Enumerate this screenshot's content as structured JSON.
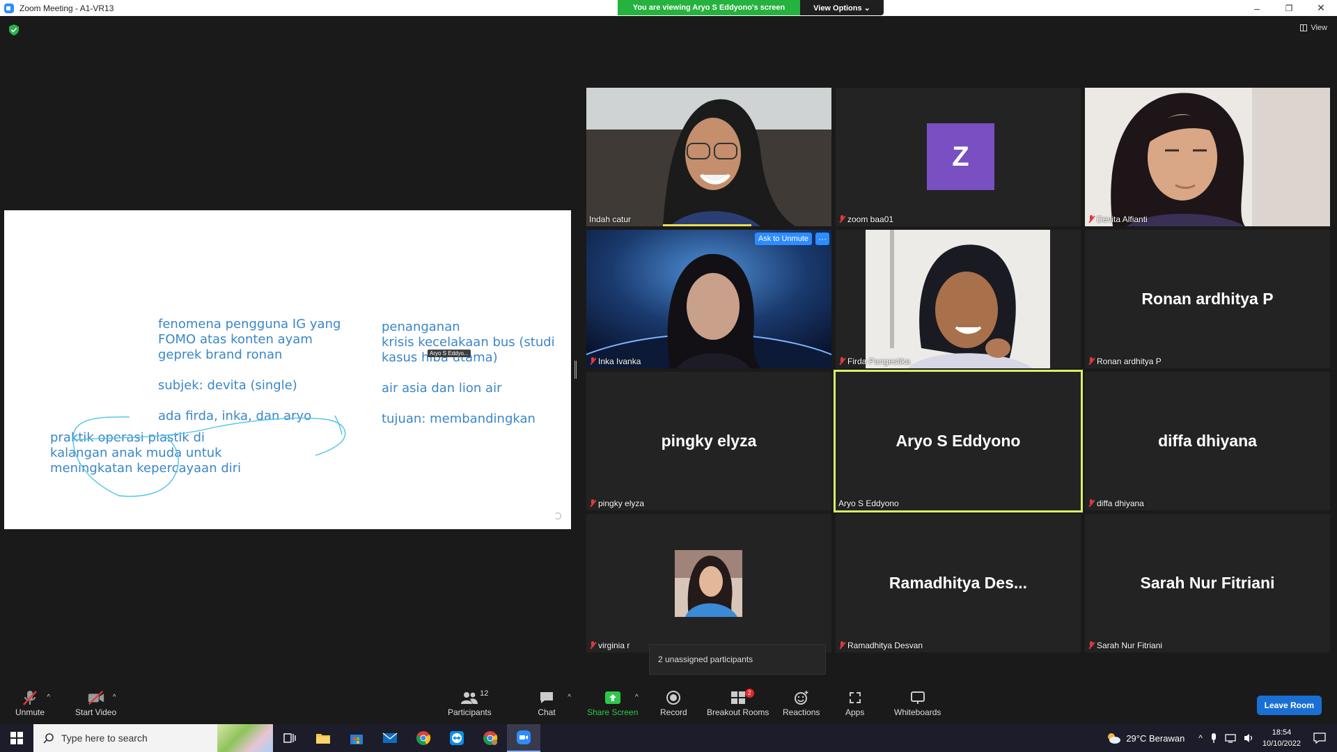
{
  "window": {
    "title": "Zoom Meeting - A1-VR13",
    "minimize": "–",
    "restore": "❐",
    "close": "✕"
  },
  "banner": {
    "message": "You are viewing Aryo S Eddyono's screen",
    "view_options": "View Options ⌄"
  },
  "view_button": "View",
  "shared_screen": {
    "left_block": "fenomena pengguna IG yang\nFOMO atas konten ayam\ngeprek brand ronan\n\nsubjek: devita (single)\n\nada firda, inka, dan aryo",
    "bottom_left_block": "praktik operasi plastik di\nkalangan anak muda untuk\nmeningkatan kepercayaan diri",
    "right_block": "penanganan\nkrisis kecelakaan bus (studi\nkasus hiba utama)\n\nair asia dan lion air\n\ntujuan: membandingkan",
    "cursor_label": "Aryo S Eddyo..."
  },
  "participants_grid": [
    {
      "name": "Indah catur",
      "type": "video",
      "muted": false
    },
    {
      "name": "zoom baa01",
      "type": "avatar",
      "initial": "Z",
      "muted": true
    },
    {
      "name": "Devita Alfianti",
      "type": "video",
      "muted": true
    },
    {
      "name": "Inka Ivanka",
      "type": "video",
      "muted": true
    },
    {
      "name": "Firda Pangestika",
      "type": "video",
      "muted": true
    },
    {
      "name": "Ronan ardhitya P",
      "display": "Ronan ardhitya P",
      "type": "name",
      "muted": true
    },
    {
      "name": "pingky elyza",
      "display": "pingky elyza",
      "type": "name",
      "muted": true
    },
    {
      "name": "Aryo S Eddyono",
      "display": "Aryo S Eddyono",
      "type": "name",
      "muted": false,
      "active_speaker": true
    },
    {
      "name": "diffa dhiyana",
      "display": "diffa dhiyana",
      "type": "name",
      "muted": true
    },
    {
      "name": "virginia r",
      "type": "photo",
      "muted": true
    },
    {
      "name": "Ramadhitya Desvan",
      "display": "Ramadhitya  Des...",
      "type": "name",
      "muted": true
    },
    {
      "name": "Sarah Nur Fitriani",
      "display": "Sarah Nur Fitriani",
      "type": "name",
      "muted": true
    }
  ],
  "tile_controls": {
    "ask_to_unmute": "Ask to Unmute",
    "more": "···"
  },
  "unassigned_tooltip": "2 unassigned participants",
  "toolbar": {
    "unmute": "Unmute",
    "start_video": "Start Video",
    "participants": "Participants",
    "participants_count": "12",
    "chat": "Chat",
    "share_screen": "Share Screen",
    "record": "Record",
    "breakout_rooms": "Breakout Rooms",
    "breakout_badge": "2",
    "reactions": "Reactions",
    "apps": "Apps",
    "whiteboards": "Whiteboards",
    "leave_room": "Leave Room"
  },
  "taskbar": {
    "search_placeholder": "Type here to search",
    "weather": "29°C  Berawan",
    "time": "18:54",
    "date": "10/10/2022"
  },
  "colors": {
    "accent_blue": "#2d8cff",
    "banner_green": "#26b23e",
    "active_speaker": "#d9ef6a",
    "muted_red": "#e03a3a",
    "share_text": "#3a86c8"
  }
}
